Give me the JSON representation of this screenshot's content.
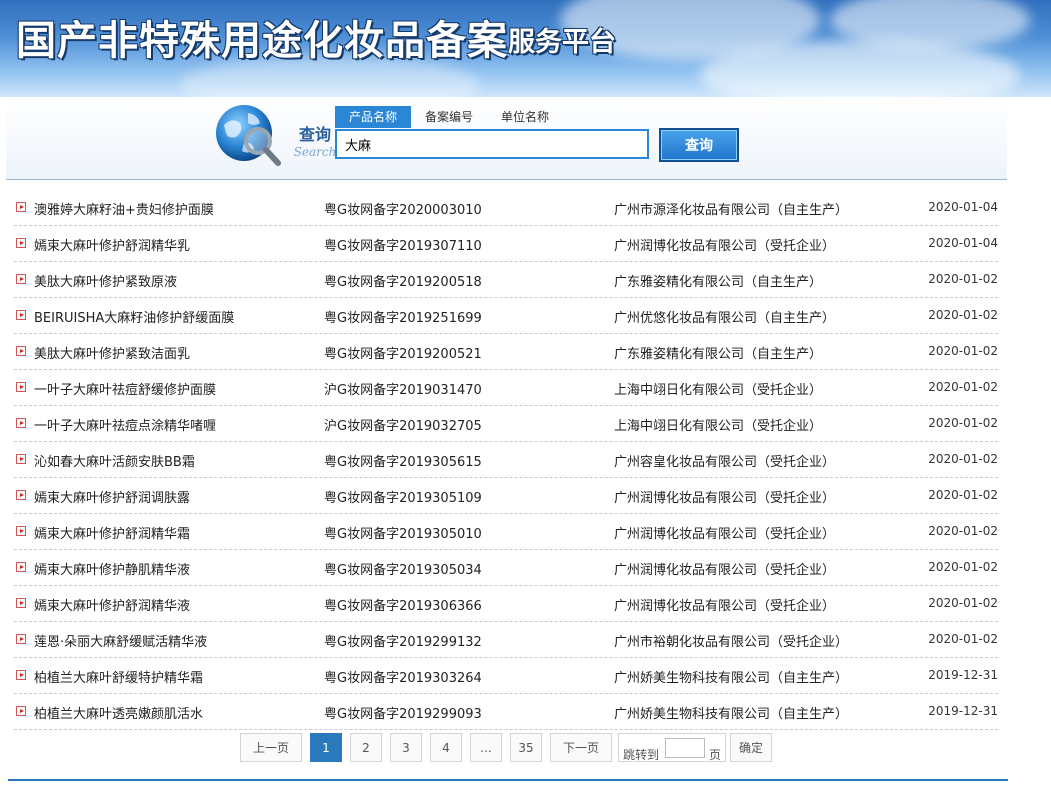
{
  "header": {
    "title": "国产非特殊用途化妆品备案",
    "subtitle": "服务平台"
  },
  "search": {
    "label_cn": "查询",
    "label_en": "Search",
    "tabs": [
      {
        "label": "产品名称",
        "active": true
      },
      {
        "label": "备案编号",
        "active": false
      },
      {
        "label": "单位名称",
        "active": false
      }
    ],
    "query": "大麻",
    "button_label": "查询"
  },
  "results": [
    {
      "name": "澳雅婷大麻籽油+贵妇修护面膜",
      "reg_no": "粤G妆网备字2020003010",
      "company": "广州市源泽化妆品有限公司（自主生产）",
      "date": "2020-01-04"
    },
    {
      "name": "嫣束大麻叶修护舒润精华乳",
      "reg_no": "粤G妆网备字2019307110",
      "company": "广州润博化妆品有限公司（受托企业）",
      "date": "2020-01-04"
    },
    {
      "name": "美肽大麻叶修护紧致原液",
      "reg_no": "粤G妆网备字2019200518",
      "company": "广东雅姿精化有限公司（自主生产）",
      "date": "2020-01-02"
    },
    {
      "name": "BEIRUISHA大麻籽油修护舒缓面膜",
      "reg_no": "粤G妆网备字2019251699",
      "company": "广州优悠化妆品有限公司（自主生产）",
      "date": "2020-01-02"
    },
    {
      "name": "美肽大麻叶修护紧致洁面乳",
      "reg_no": "粤G妆网备字2019200521",
      "company": "广东雅姿精化有限公司（自主生产）",
      "date": "2020-01-02"
    },
    {
      "name": "一叶子大麻叶祛痘舒缓修护面膜",
      "reg_no": "沪G妆网备字2019031470",
      "company": "上海中翊日化有限公司（受托企业）",
      "date": "2020-01-02"
    },
    {
      "name": "一叶子大麻叶祛痘点涂精华啫喱",
      "reg_no": "沪G妆网备字2019032705",
      "company": "上海中翊日化有限公司（受托企业）",
      "date": "2020-01-02"
    },
    {
      "name": "沁如春大麻叶活颜安肤BB霜",
      "reg_no": "粤G妆网备字2019305615",
      "company": "广州容皇化妆品有限公司（受托企业）",
      "date": "2020-01-02"
    },
    {
      "name": "嫣束大麻叶修护舒润调肤露",
      "reg_no": "粤G妆网备字2019305109",
      "company": "广州润博化妆品有限公司（受托企业）",
      "date": "2020-01-02"
    },
    {
      "name": "嫣束大麻叶修护舒润精华霜",
      "reg_no": "粤G妆网备字2019305010",
      "company": "广州润博化妆品有限公司（受托企业）",
      "date": "2020-01-02"
    },
    {
      "name": "嫣束大麻叶修护静肌精华液",
      "reg_no": "粤G妆网备字2019305034",
      "company": "广州润博化妆品有限公司（受托企业）",
      "date": "2020-01-02"
    },
    {
      "name": "嫣束大麻叶修护舒润精华液",
      "reg_no": "粤G妆网备字2019306366",
      "company": "广州润博化妆品有限公司（受托企业）",
      "date": "2020-01-02"
    },
    {
      "name": "莲恩·朵丽大麻舒缓赋活精华液",
      "reg_no": "粤G妆网备字2019299132",
      "company": "广州市裕朝化妆品有限公司（受托企业）",
      "date": "2020-01-02"
    },
    {
      "name": "柏植兰大麻叶舒缓特护精华霜",
      "reg_no": "粤G妆网备字2019303264",
      "company": "广州娇美生物科技有限公司（自主生产）",
      "date": "2019-12-31"
    },
    {
      "name": "柏植兰大麻叶透亮嫩颜肌活水",
      "reg_no": "粤G妆网备字2019299093",
      "company": "广州娇美生物科技有限公司（自主生产）",
      "date": "2019-12-31"
    }
  ],
  "pagination": {
    "prev_label": "上一页",
    "pages": [
      "1",
      "2",
      "3",
      "4"
    ],
    "current": "1",
    "ellipsis": "...",
    "last": "35",
    "next_label": "下一页",
    "jump_label": "跳转到",
    "page_suffix": "页",
    "confirm_label": "确定",
    "jump_value": ""
  },
  "colors": {
    "accent": "#2b86d6",
    "active_page": "#2a79bd",
    "bullet": "#c62828"
  }
}
